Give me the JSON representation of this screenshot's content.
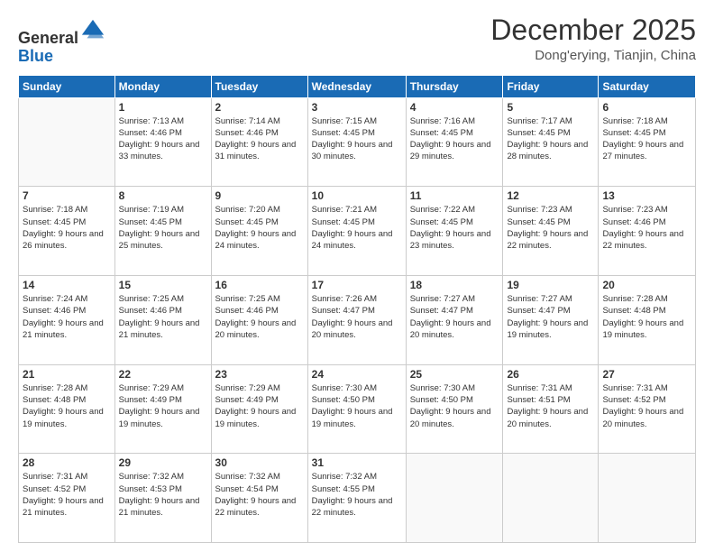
{
  "logo": {
    "general": "General",
    "blue": "Blue"
  },
  "header": {
    "month": "December 2025",
    "location": "Dong'erying, Tianjin, China"
  },
  "days_of_week": [
    "Sunday",
    "Monday",
    "Tuesday",
    "Wednesday",
    "Thursday",
    "Friday",
    "Saturday"
  ],
  "weeks": [
    [
      {
        "day": "",
        "info": ""
      },
      {
        "day": "1",
        "info": "Sunrise: 7:13 AM\nSunset: 4:46 PM\nDaylight: 9 hours\nand 33 minutes."
      },
      {
        "day": "2",
        "info": "Sunrise: 7:14 AM\nSunset: 4:46 PM\nDaylight: 9 hours\nand 31 minutes."
      },
      {
        "day": "3",
        "info": "Sunrise: 7:15 AM\nSunset: 4:45 PM\nDaylight: 9 hours\nand 30 minutes."
      },
      {
        "day": "4",
        "info": "Sunrise: 7:16 AM\nSunset: 4:45 PM\nDaylight: 9 hours\nand 29 minutes."
      },
      {
        "day": "5",
        "info": "Sunrise: 7:17 AM\nSunset: 4:45 PM\nDaylight: 9 hours\nand 28 minutes."
      },
      {
        "day": "6",
        "info": "Sunrise: 7:18 AM\nSunset: 4:45 PM\nDaylight: 9 hours\nand 27 minutes."
      }
    ],
    [
      {
        "day": "7",
        "info": "Sunrise: 7:18 AM\nSunset: 4:45 PM\nDaylight: 9 hours\nand 26 minutes."
      },
      {
        "day": "8",
        "info": "Sunrise: 7:19 AM\nSunset: 4:45 PM\nDaylight: 9 hours\nand 25 minutes."
      },
      {
        "day": "9",
        "info": "Sunrise: 7:20 AM\nSunset: 4:45 PM\nDaylight: 9 hours\nand 24 minutes."
      },
      {
        "day": "10",
        "info": "Sunrise: 7:21 AM\nSunset: 4:45 PM\nDaylight: 9 hours\nand 24 minutes."
      },
      {
        "day": "11",
        "info": "Sunrise: 7:22 AM\nSunset: 4:45 PM\nDaylight: 9 hours\nand 23 minutes."
      },
      {
        "day": "12",
        "info": "Sunrise: 7:23 AM\nSunset: 4:45 PM\nDaylight: 9 hours\nand 22 minutes."
      },
      {
        "day": "13",
        "info": "Sunrise: 7:23 AM\nSunset: 4:46 PM\nDaylight: 9 hours\nand 22 minutes."
      }
    ],
    [
      {
        "day": "14",
        "info": "Sunrise: 7:24 AM\nSunset: 4:46 PM\nDaylight: 9 hours\nand 21 minutes."
      },
      {
        "day": "15",
        "info": "Sunrise: 7:25 AM\nSunset: 4:46 PM\nDaylight: 9 hours\nand 21 minutes."
      },
      {
        "day": "16",
        "info": "Sunrise: 7:25 AM\nSunset: 4:46 PM\nDaylight: 9 hours\nand 20 minutes."
      },
      {
        "day": "17",
        "info": "Sunrise: 7:26 AM\nSunset: 4:47 PM\nDaylight: 9 hours\nand 20 minutes."
      },
      {
        "day": "18",
        "info": "Sunrise: 7:27 AM\nSunset: 4:47 PM\nDaylight: 9 hours\nand 20 minutes."
      },
      {
        "day": "19",
        "info": "Sunrise: 7:27 AM\nSunset: 4:47 PM\nDaylight: 9 hours\nand 19 minutes."
      },
      {
        "day": "20",
        "info": "Sunrise: 7:28 AM\nSunset: 4:48 PM\nDaylight: 9 hours\nand 19 minutes."
      }
    ],
    [
      {
        "day": "21",
        "info": "Sunrise: 7:28 AM\nSunset: 4:48 PM\nDaylight: 9 hours\nand 19 minutes."
      },
      {
        "day": "22",
        "info": "Sunrise: 7:29 AM\nSunset: 4:49 PM\nDaylight: 9 hours\nand 19 minutes."
      },
      {
        "day": "23",
        "info": "Sunrise: 7:29 AM\nSunset: 4:49 PM\nDaylight: 9 hours\nand 19 minutes."
      },
      {
        "day": "24",
        "info": "Sunrise: 7:30 AM\nSunset: 4:50 PM\nDaylight: 9 hours\nand 19 minutes."
      },
      {
        "day": "25",
        "info": "Sunrise: 7:30 AM\nSunset: 4:50 PM\nDaylight: 9 hours\nand 20 minutes."
      },
      {
        "day": "26",
        "info": "Sunrise: 7:31 AM\nSunset: 4:51 PM\nDaylight: 9 hours\nand 20 minutes."
      },
      {
        "day": "27",
        "info": "Sunrise: 7:31 AM\nSunset: 4:52 PM\nDaylight: 9 hours\nand 20 minutes."
      }
    ],
    [
      {
        "day": "28",
        "info": "Sunrise: 7:31 AM\nSunset: 4:52 PM\nDaylight: 9 hours\nand 21 minutes."
      },
      {
        "day": "29",
        "info": "Sunrise: 7:32 AM\nSunset: 4:53 PM\nDaylight: 9 hours\nand 21 minutes."
      },
      {
        "day": "30",
        "info": "Sunrise: 7:32 AM\nSunset: 4:54 PM\nDaylight: 9 hours\nand 22 minutes."
      },
      {
        "day": "31",
        "info": "Sunrise: 7:32 AM\nSunset: 4:55 PM\nDaylight: 9 hours\nand 22 minutes."
      },
      {
        "day": "",
        "info": ""
      },
      {
        "day": "",
        "info": ""
      },
      {
        "day": "",
        "info": ""
      }
    ]
  ]
}
